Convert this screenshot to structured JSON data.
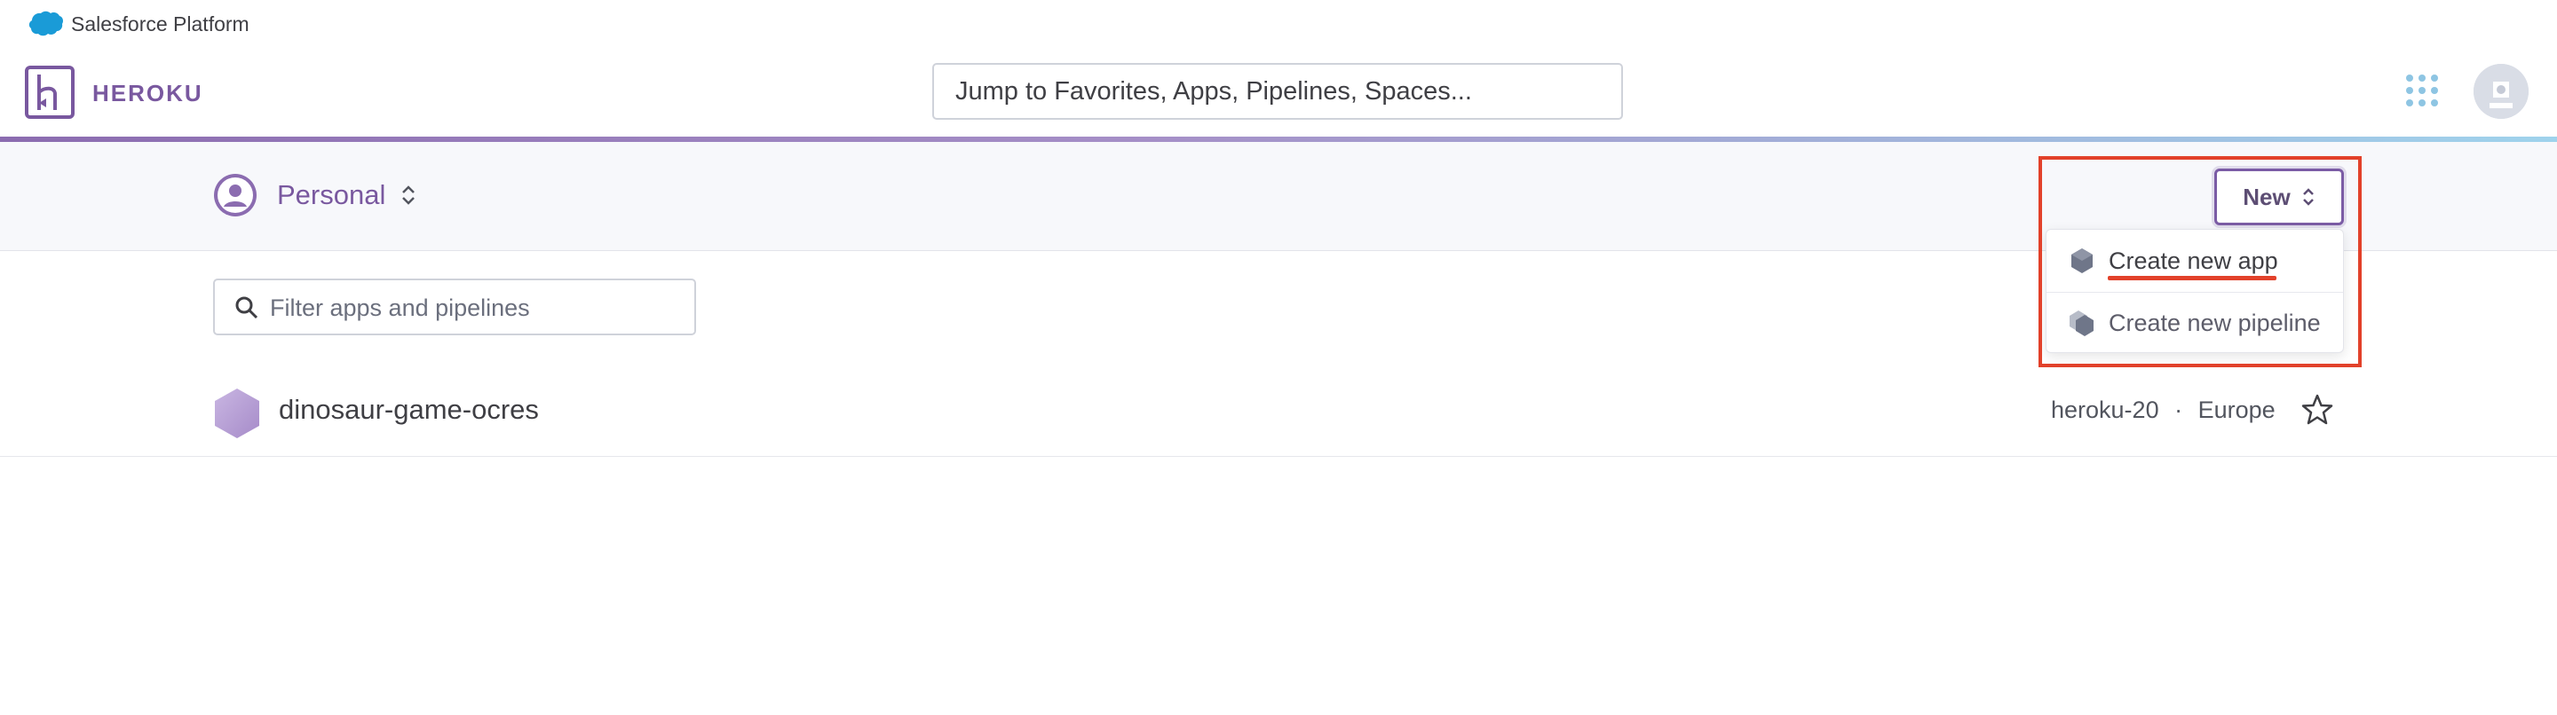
{
  "salesforce_bar": {
    "title": "Salesforce Platform",
    "logo_icon": "salesforce-cloud-icon"
  },
  "header": {
    "wordmark": "HEROKU",
    "logo_icon": "heroku-logo-icon",
    "search_placeholder": "Jump to Favorites, Apps, Pipelines, Spaces...",
    "apps_icon": "apps-grid-icon",
    "avatar_icon": "user-avatar-icon",
    "accent_color": "#79589f"
  },
  "context": {
    "team_label": "Personal",
    "new_button_label": "New"
  },
  "new_menu": {
    "items": [
      {
        "label": "Create new app",
        "icon": "app-hexagon-icon"
      },
      {
        "label": "Create new pipeline",
        "icon": "pipeline-hexagons-icon"
      }
    ]
  },
  "filter": {
    "placeholder": "Filter apps and pipelines"
  },
  "apps": [
    {
      "name": "dinosaur-game-ocres",
      "stack": "heroku-20",
      "separator": "·",
      "region": "Europe",
      "favorite": false
    }
  ],
  "annotation_color": "#e2412a"
}
